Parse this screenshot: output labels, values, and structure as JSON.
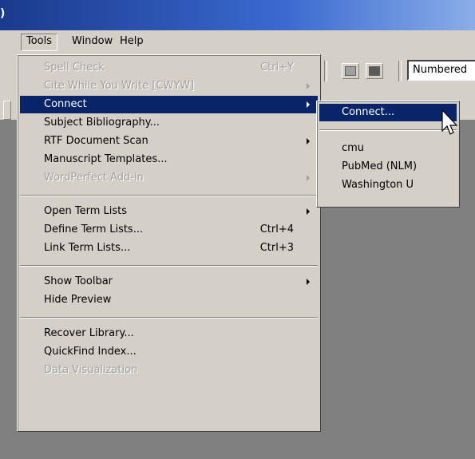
{
  "titlebar": {
    "glyph": ")"
  },
  "menubar": {
    "items": [
      "Tools",
      "Window",
      "Help"
    ]
  },
  "toolbar": {
    "style_select_value": "Numbered",
    "buttons": [
      "image-icon",
      "picture-icon"
    ]
  },
  "tools_menu": {
    "items": [
      {
        "label": "Spell Check",
        "shortcut": "Ctrl+Y",
        "state": "disabled"
      },
      {
        "label": "Cite While You Write [CWYW]",
        "submenu": true,
        "state": "disabled"
      },
      {
        "label": "Connect",
        "submenu": true,
        "state": "highlighted"
      },
      {
        "label": "Subject Bibliography...",
        "state": "enabled"
      },
      {
        "label": "RTF Document Scan",
        "submenu": true,
        "state": "enabled"
      },
      {
        "label": "Manuscript Templates...",
        "state": "enabled"
      },
      {
        "label": "WordPerfect Add-in",
        "submenu": true,
        "state": "disabled"
      },
      {
        "label": "Open Term Lists",
        "submenu": true,
        "state": "enabled"
      },
      {
        "label": "Define Term Lists...",
        "shortcut": "Ctrl+4",
        "state": "enabled"
      },
      {
        "label": "Link Term Lists...",
        "shortcut": "Ctrl+3",
        "state": "enabled"
      },
      {
        "label": "Show Toolbar",
        "submenu": true,
        "state": "enabled"
      },
      {
        "label": "Hide Preview",
        "state": "enabled"
      },
      {
        "label": "Recover Library...",
        "state": "enabled"
      },
      {
        "label": "QuickFind Index...",
        "state": "enabled"
      },
      {
        "label": "Data Visualization",
        "state": "disabled"
      }
    ]
  },
  "connect_submenu": {
    "items": [
      {
        "label": "Connect...",
        "state": "highlighted"
      },
      {
        "label": "cmu",
        "state": "enabled"
      },
      {
        "label": "PubMed (NLM)",
        "state": "enabled"
      },
      {
        "label": "Washington U",
        "state": "enabled"
      }
    ]
  },
  "colors": {
    "highlight": "#0a246a",
    "menu_bg": "#d4d0c8",
    "workspace": "#808080",
    "disabled_text": "#a0a0a0"
  }
}
